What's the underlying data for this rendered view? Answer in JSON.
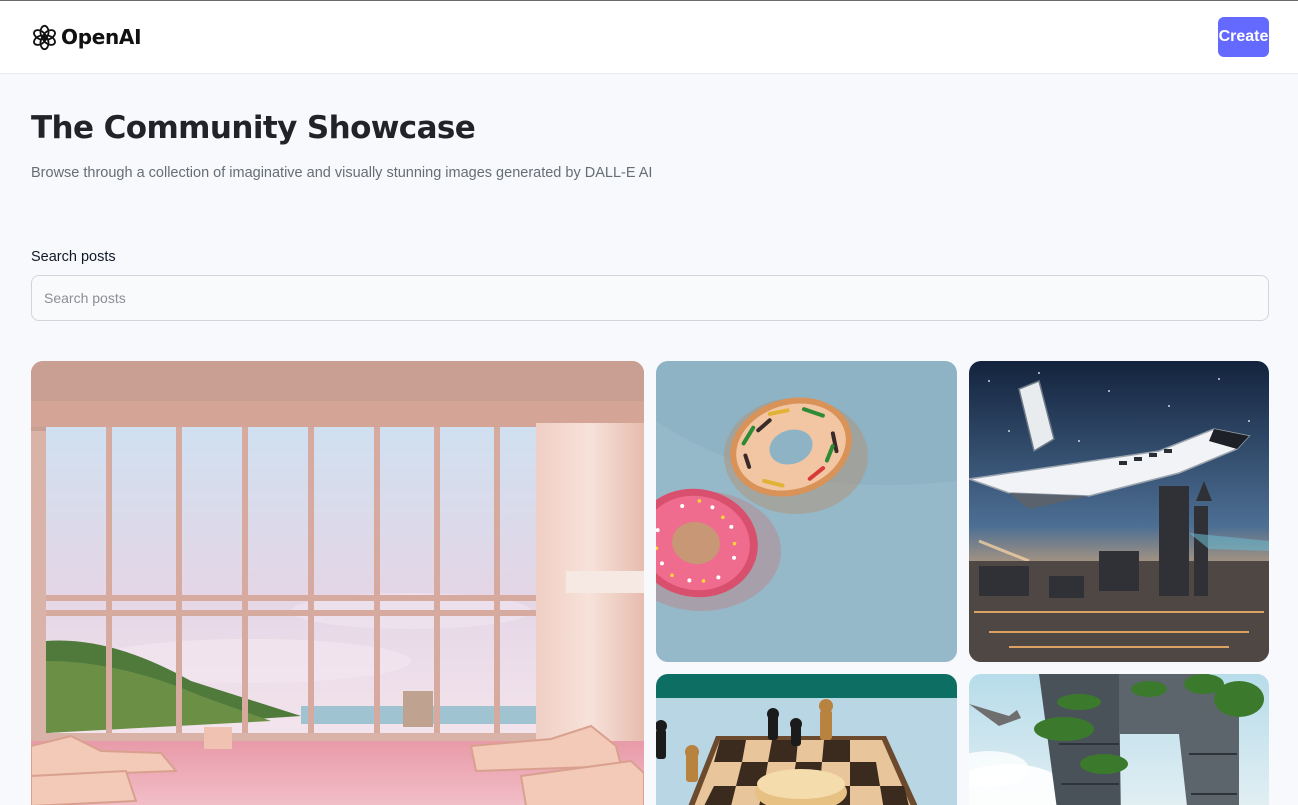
{
  "header": {
    "logo_text": "OpenAI",
    "logo_icon": "openai-logo-icon",
    "create_label": "Create"
  },
  "main": {
    "title": "The Community Showcase",
    "subtitle": "Browse through a collection of imaginative and visually stunning images generated by DALL-E AI"
  },
  "search": {
    "label": "Search posts",
    "placeholder": "Search posts",
    "value": ""
  },
  "posts": [
    {
      "image": "lounge-with-tall-windows-image"
    },
    {
      "image": "donuts-floating-in-water-image"
    },
    {
      "image": "space-shuttle-over-city-image"
    },
    {
      "image": "chess-board-image"
    },
    {
      "image": "overgrown-tower-image"
    }
  ],
  "colors": {
    "accent": "#6469ff",
    "page_background": "#f8f9fc",
    "header_background": "#ffffff",
    "title": "#222328",
    "subtitle": "#666e75"
  }
}
